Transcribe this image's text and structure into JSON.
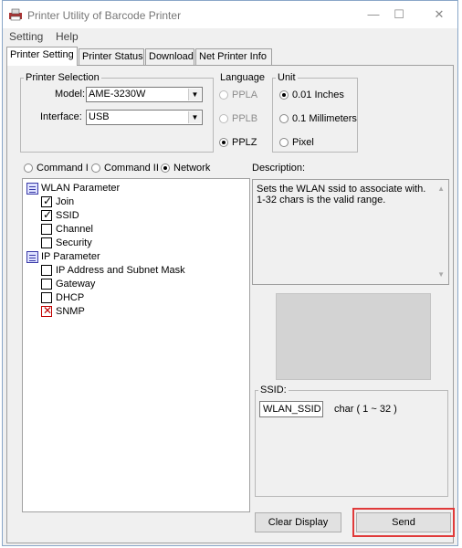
{
  "window": {
    "title": "Printer Utility of Barcode Printer",
    "minimize": "—",
    "maximize": "☐",
    "close": "✕"
  },
  "menu": [
    "Setting",
    "Help"
  ],
  "tabs": [
    "Printer Setting",
    "Printer Status",
    "Download",
    "Net Printer Info"
  ],
  "active_tab": "Printer Setting",
  "printer_selection": {
    "legend": "Printer Selection",
    "model_label": "Model:",
    "model_value": "AME-3230W",
    "interface_label": "Interface:",
    "interface_value": "USB"
  },
  "language": {
    "legend": "Language",
    "options": [
      "PPLA",
      "PPLB",
      "PPLZ"
    ],
    "selected": "PPLZ"
  },
  "unit": {
    "legend": "Unit",
    "options": [
      "0.01 Inches",
      "0.1 Millimeters",
      "Pixel"
    ],
    "selected": "0.01 Inches"
  },
  "command_mode": {
    "options": [
      "Command I",
      "Command II",
      "Network"
    ],
    "selected": "Network"
  },
  "tree": {
    "groups": [
      {
        "label": "WLAN Parameter",
        "items": [
          {
            "label": "Join",
            "state": "checked"
          },
          {
            "label": "SSID",
            "state": "checked"
          },
          {
            "label": "Channel",
            "state": "unchecked"
          },
          {
            "label": "Security",
            "state": "unchecked"
          }
        ]
      },
      {
        "label": "IP Parameter",
        "items": [
          {
            "label": "IP Address and Subnet Mask",
            "state": "unchecked"
          },
          {
            "label": "Gateway",
            "state": "unchecked"
          },
          {
            "label": "DHCP",
            "state": "unchecked"
          },
          {
            "label": "SNMP",
            "state": "error"
          }
        ]
      }
    ]
  },
  "description": {
    "label": "Description:",
    "lines": [
      "Sets the WLAN ssid to associate with.",
      "1-32 chars is the valid range."
    ]
  },
  "ssid": {
    "legend": "SSID:",
    "value": "WLAN_SSID",
    "hint": "char ( 1 ~ 32 )"
  },
  "buttons": {
    "clear": "Clear Display",
    "send": "Send"
  },
  "colors": {
    "highlight": "#e03a3a",
    "preview_bg": "#d3d3d3",
    "error_mark": "#c00000"
  }
}
